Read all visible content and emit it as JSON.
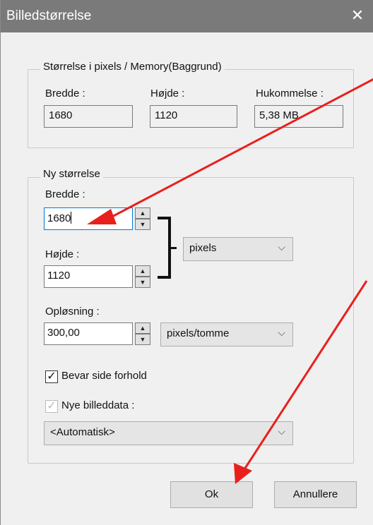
{
  "window": {
    "title": "Billedstørrelse",
    "close_glyph": "✕"
  },
  "current": {
    "legend": "Størrelse i pixels / Memory(Baggrund)",
    "width_label": "Bredde :",
    "height_label": "Højde :",
    "memory_label": "Hukommelse :",
    "width_value": "1680",
    "height_value": "1120",
    "memory_value": "5,38 MB"
  },
  "new_size": {
    "legend": "Ny størrelse",
    "width_label": "Bredde :",
    "width_value": "1680",
    "height_label": "Højde :",
    "height_value": "1120",
    "unit_selected": "pixels",
    "resolution_label": "Opløsning :",
    "resolution_value": "300,00",
    "resolution_unit_selected": "pixels/tomme",
    "keep_ratio_label": "Bevar side forhold",
    "keep_ratio_checked": true,
    "new_data_label": "Nye billeddata :",
    "new_data_checked": true,
    "new_data_enabled": false,
    "resample_selected": "<Automatisk>"
  },
  "buttons": {
    "ok_label": "Ok",
    "cancel_label": "Annullere"
  },
  "glyphs": {
    "check": "✓",
    "spin_up": "▲",
    "spin_down": "▼",
    "chevron": "⌵"
  },
  "colors": {
    "annotation_arrow": "#e8201c",
    "focus": "#0078d7",
    "titlebar": "#7a7a7a"
  }
}
